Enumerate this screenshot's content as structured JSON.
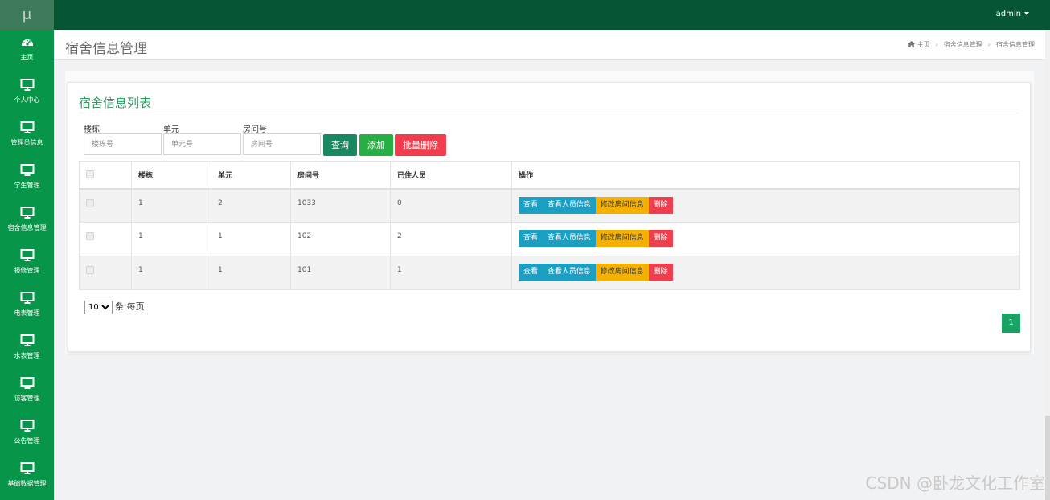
{
  "app": {
    "logo_text": "μ"
  },
  "user": {
    "name": "admin"
  },
  "sidebar": {
    "items": [
      {
        "icon": "dashboard-icon",
        "label": "主页"
      },
      {
        "icon": "monitor-icon",
        "label": "个人中心"
      },
      {
        "icon": "monitor-icon",
        "label": "管理员信息"
      },
      {
        "icon": "monitor-icon",
        "label": "学生管理"
      },
      {
        "icon": "monitor-icon",
        "label": "宿舍信息管理"
      },
      {
        "icon": "monitor-icon",
        "label": "报修管理"
      },
      {
        "icon": "monitor-icon",
        "label": "电表管理"
      },
      {
        "icon": "monitor-icon",
        "label": "水表管理"
      },
      {
        "icon": "monitor-icon",
        "label": "访客管理"
      },
      {
        "icon": "monitor-icon",
        "label": "公告管理"
      },
      {
        "icon": "monitor-icon",
        "label": "基础数据管理"
      }
    ]
  },
  "header": {
    "title": "宿舍信息管理",
    "breadcrumb": [
      "主页",
      "宿舍信息管理",
      "宿舍信息管理"
    ]
  },
  "panel": {
    "title": "宿舍信息列表"
  },
  "filters": [
    {
      "label": "楼栋",
      "placeholder": "楼栋号",
      "value": ""
    },
    {
      "label": "单元",
      "placeholder": "单元号",
      "value": ""
    },
    {
      "label": "房间号",
      "placeholder": "房间号",
      "value": ""
    }
  ],
  "buttons": {
    "query": "查询",
    "add": "添加",
    "batch_delete": "批量删除"
  },
  "table": {
    "columns": [
      "楼栋",
      "单元",
      "房间号",
      "已住人员",
      "操作"
    ],
    "rows": [
      {
        "building": "1",
        "unit": "2",
        "room": "1033",
        "occupants": "0"
      },
      {
        "building": "1",
        "unit": "1",
        "room": "102",
        "occupants": "2"
      },
      {
        "building": "1",
        "unit": "1",
        "room": "101",
        "occupants": "1"
      }
    ],
    "actions": {
      "view": "查看",
      "view_people": "查看人员信息",
      "edit_room": "修改房间信息",
      "delete": "删除"
    }
  },
  "pagination": {
    "page_size": "10",
    "page_size_suffix": "条 每页",
    "current_page": "1"
  },
  "watermark": "CSDN @卧龙文化工作室",
  "colors": {
    "topbar": "#065636",
    "sidebar": "#079649",
    "accent": "#2f9a5f"
  }
}
